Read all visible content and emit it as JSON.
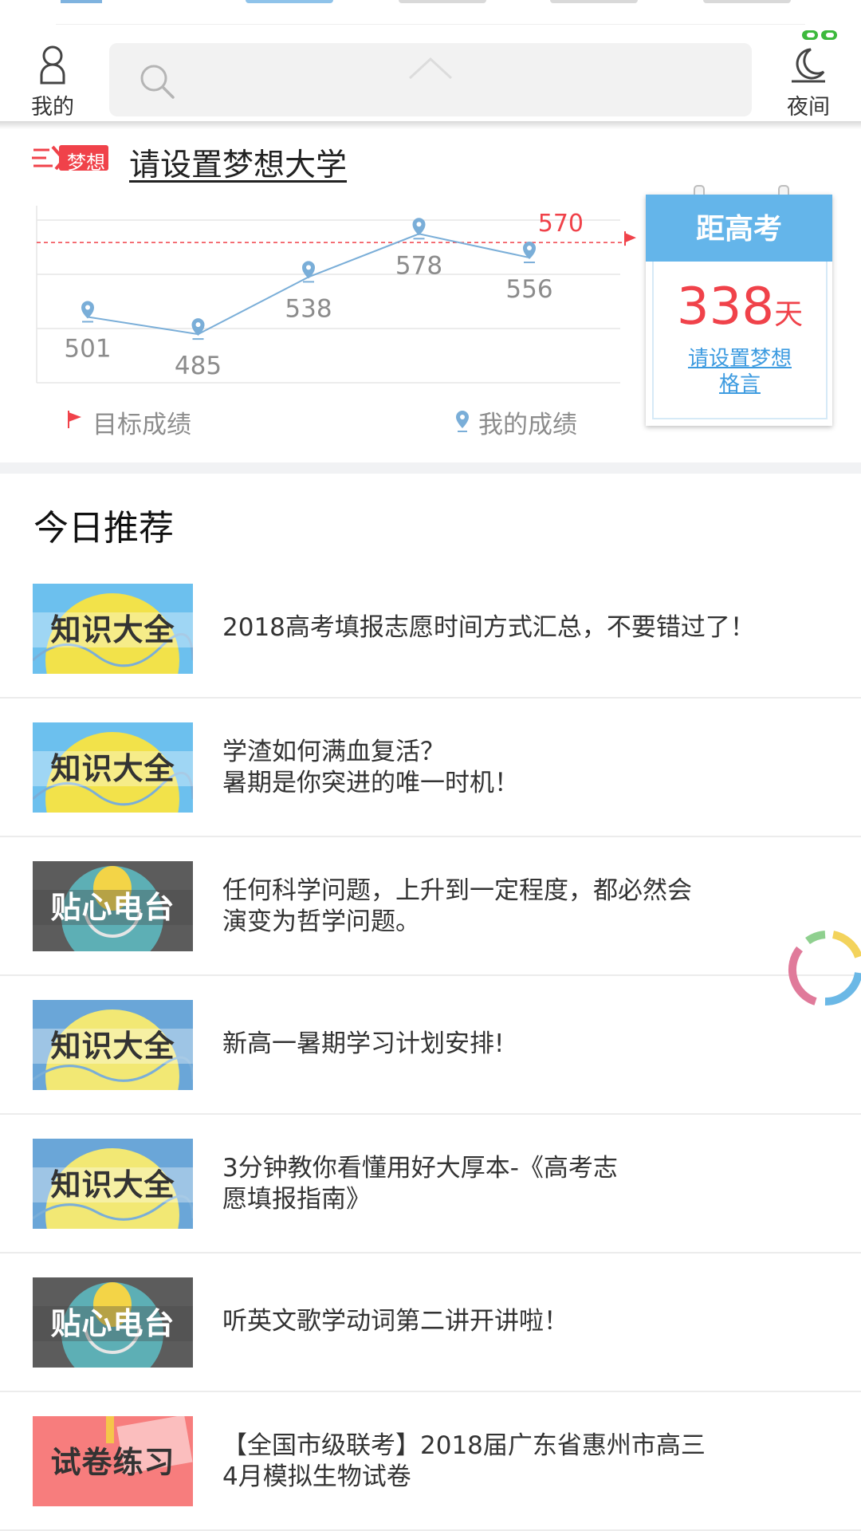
{
  "header": {
    "profile_label": "我的",
    "night_label": "夜间"
  },
  "dream": {
    "tag": "梦想",
    "title": "请设置梦想大学"
  },
  "chart_data": {
    "type": "line",
    "series": [
      {
        "name": "我的成绩",
        "values": [
          501,
          485,
          538,
          578,
          556
        ]
      }
    ],
    "target": {
      "name": "目标成绩",
      "value": 570
    },
    "ylim": [
      440,
      610
    ],
    "grid": true,
    "legend_placement": "bottom"
  },
  "legend": {
    "target_label": "目标成绩",
    "mine_label": "我的成绩"
  },
  "countdown": {
    "title": "距高考",
    "days": "338",
    "unit": "天",
    "motto_line1": "请设置梦想",
    "motto_line2": "格言"
  },
  "recommend": {
    "title": "今日推荐",
    "items": [
      {
        "thumb": "知识大全",
        "style": "knowledge",
        "lines": [
          "2018高考填报志愿时间方式汇总，不要错过了！"
        ]
      },
      {
        "thumb": "知识大全",
        "style": "knowledge",
        "lines": [
          "学渣如何满血复活？",
          "暑期是你突进的唯一时机！"
        ]
      },
      {
        "thumb": "贴心电台",
        "style": "radio",
        "lines": [
          "任何科学问题，上升到一定程度，都必然会",
          "演变为哲学问题。"
        ]
      },
      {
        "thumb": "知识大全",
        "style": "knowledge2",
        "lines": [
          "新高一暑期学习计划安排!"
        ]
      },
      {
        "thumb": "知识大全",
        "style": "knowledge2",
        "lines": [
          "3分钟教你看懂用好大厚本-《高考志",
          "愿填报指南》"
        ]
      },
      {
        "thumb": "贴心电台",
        "style": "radio",
        "lines": [
          "听英文歌学动词第二讲开讲啦！"
        ]
      },
      {
        "thumb": "试卷练习",
        "style": "paper",
        "lines": [
          "【全国市级联考】2018届广东省惠州市高三",
          "4月模拟生物试卷"
        ]
      }
    ]
  },
  "colors": {
    "accent_blue": "#64b5ea",
    "line_blue": "#7aaed8",
    "target_red": "#f0424a",
    "countdown_red": "#f0424a"
  }
}
